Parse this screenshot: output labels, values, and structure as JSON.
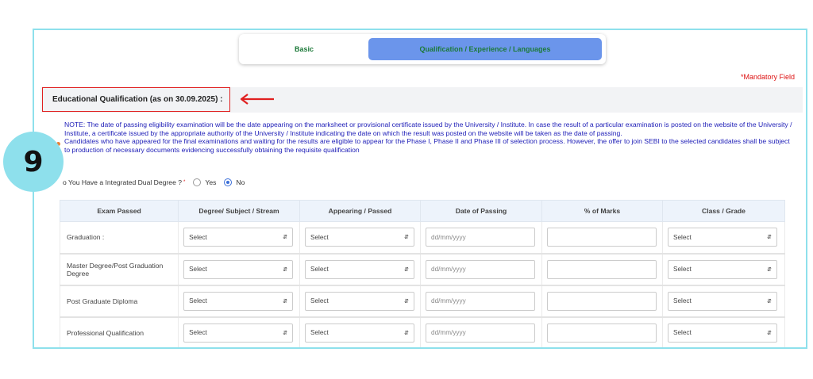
{
  "tabs": [
    {
      "label": "Basic"
    },
    {
      "label": "Qualification / Experience / Languages"
    }
  ],
  "mandatory": "*Mandatory Field",
  "section_title": "Educational Qualification (as on 30.09.2025) :",
  "note": {
    "line1": "NOTE: The date of passing eligibility examination will be the date appearing on the marksheet or provisional certificate issued by the University / Institute. In case the result of a particular examination is posted on the website of the University / Institute, a certificate issued by the appropriate authority of the University / Institute indicating the date on which the result was posted on the website will be taken as the date of passing.",
    "line2": "Candidates who have appeared for the final examinations and waiting for the results are eligible to appear for the Phase I, Phase II and Phase III of selection process. However, the offer to join SEBI to the selected candidates shall be subject to production of necessary documents evidencing successfully obtaining the requisite qualification"
  },
  "dual_degree": {
    "question": "o You Have a Integrated Dual Degree ?",
    "required_mark": "*",
    "yes": "Yes",
    "no": "No",
    "selected": "No"
  },
  "step_badge": "9",
  "table": {
    "headers": [
      "Exam Passed",
      "Degree/ Subject / Stream",
      "Appearing / Passed",
      "Date of Passing",
      "% of Marks",
      "Class / Grade"
    ],
    "select_placeholder": "Select",
    "date_placeholder": "dd/mm/yyyy",
    "rows": [
      {
        "label": "Graduation :"
      },
      {
        "label": "Master Degree/Post Graduation Degree"
      },
      {
        "label": "Post Graduate Diploma"
      },
      {
        "label": "Professional Qualification"
      }
    ]
  }
}
